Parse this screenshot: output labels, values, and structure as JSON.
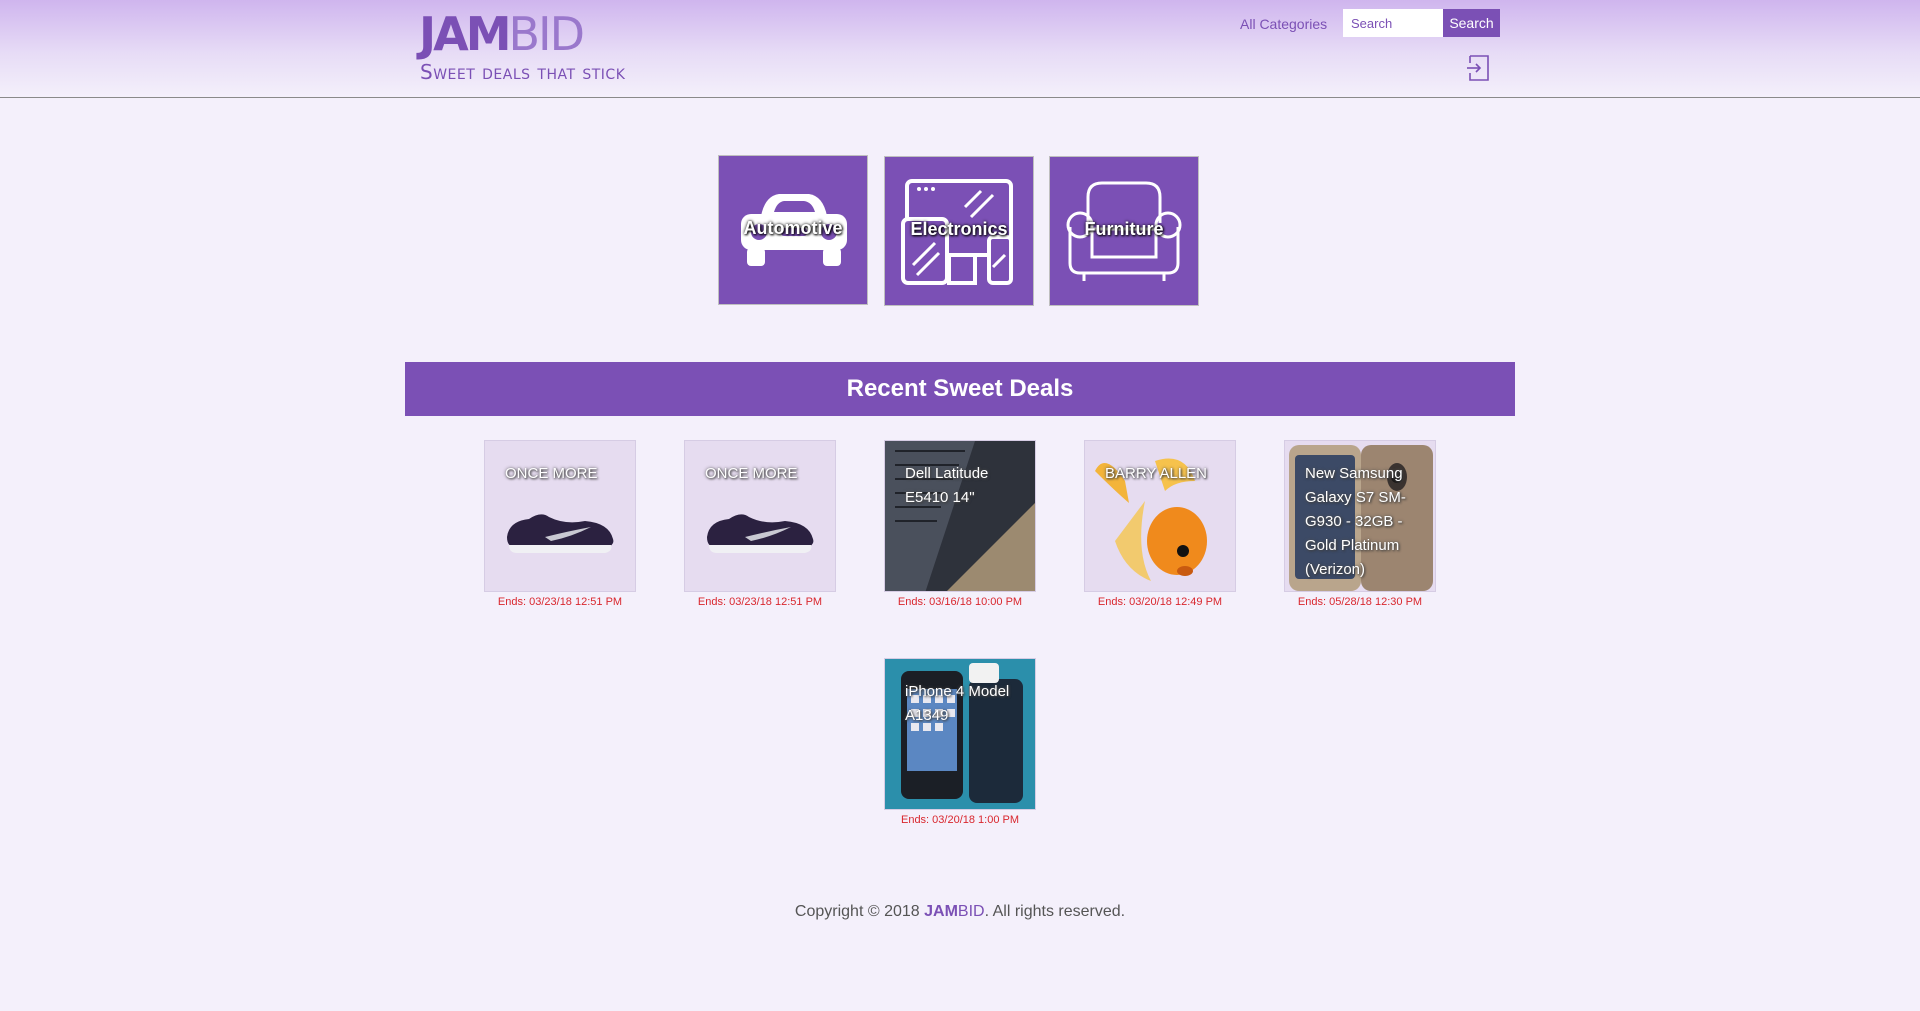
{
  "brand": {
    "logo_bold": "JAM",
    "logo_light": "BID",
    "tagline": "Sweet deals that stick"
  },
  "header": {
    "all_categories": "All Categories",
    "search_placeholder": "Search",
    "search_button": "Search",
    "login_icon": "sign-in-icon"
  },
  "categories": [
    {
      "label": "Automotive",
      "icon": "car-icon"
    },
    {
      "label": "Electronics",
      "icon": "devices-icon"
    },
    {
      "label": "Furniture",
      "icon": "armchair-icon"
    }
  ],
  "deals_heading": "Recent Sweet Deals",
  "deals": [
    {
      "title": "ONCE MORE",
      "ends": "Ends: 03/23/18 12:51 PM",
      "image": "sneaker"
    },
    {
      "title": "ONCE MORE",
      "ends": "Ends: 03/23/18 12:51 PM",
      "image": "sneaker"
    },
    {
      "title": "Dell Latitude E5410 14\"",
      "ends": "Ends: 03/16/18 10:00 PM",
      "image": "laptop"
    },
    {
      "title": "BARRY ALLEN",
      "ends": "Ends: 03/20/18 12:49 PM",
      "image": "goldfish"
    },
    {
      "title": "New Samsung Galaxy S7 SM-G930 - 32GB - Gold Platinum (Verizon)",
      "ends": "Ends: 05/28/18 12:30 PM",
      "image": "smartphone"
    },
    {
      "title": "iPhone 4 Model A1349",
      "ends": "Ends: 03/20/18 1:00 PM",
      "image": "iphone"
    }
  ],
  "footer": {
    "prefix": "Copyright © 2018 ",
    "brand_bold": "JAM",
    "brand_light": "BID",
    "suffix": ". All rights reserved."
  },
  "colors": {
    "accent": "#7b50b5",
    "background": "#f4f0fb",
    "ends_text": "#d9272e"
  }
}
